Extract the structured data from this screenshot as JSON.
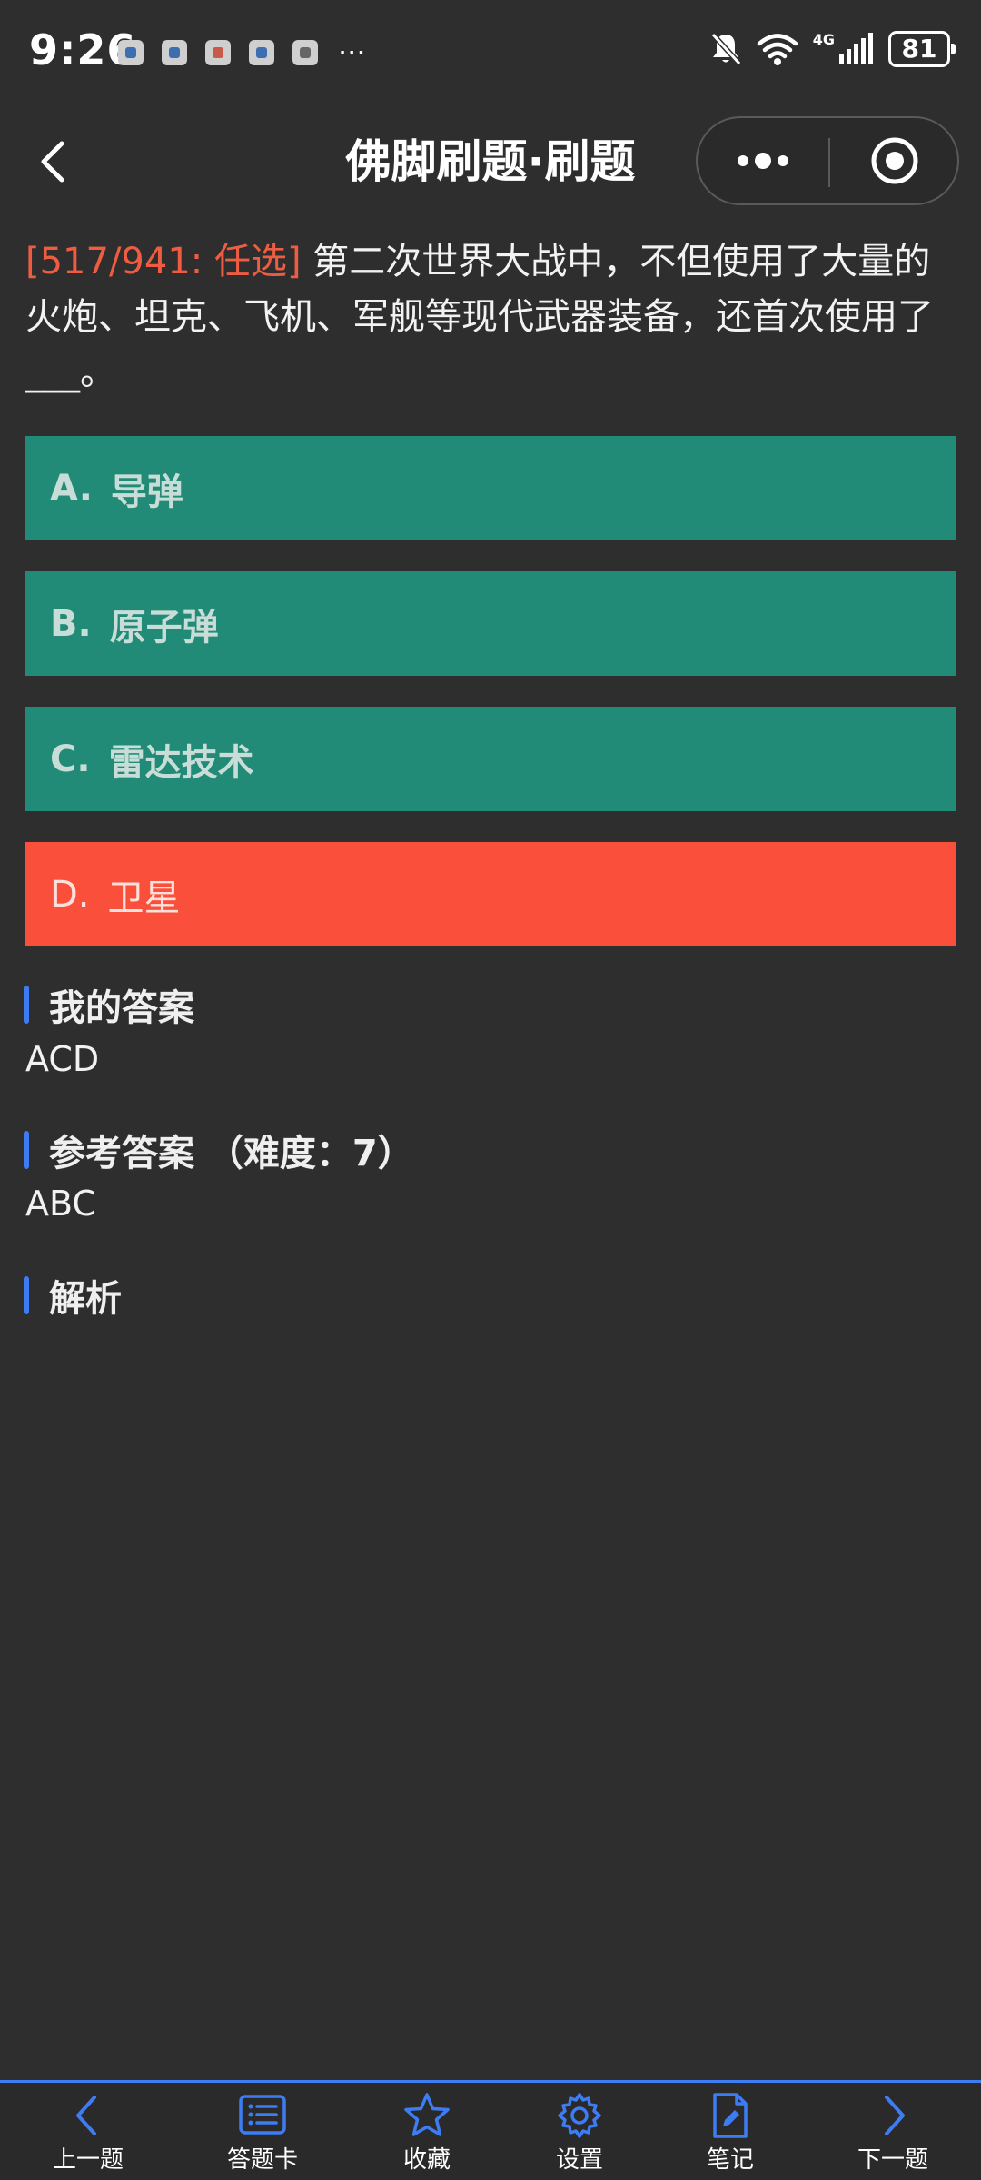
{
  "status_bar": {
    "time": "9:26",
    "more": "···",
    "network": "4G",
    "battery": "81"
  },
  "header": {
    "title": "佛脚刷题·刷题"
  },
  "question": {
    "tag": "[517/941: 任选]",
    "text": " 第二次世界大战中，不但使用了大量的火炮、坦克、飞机、军舰等现代武器装备，还首次使用了___。"
  },
  "options": [
    {
      "letter": "A.",
      "text": "导弹",
      "status": "correct"
    },
    {
      "letter": "B.",
      "text": "原子弹",
      "status": "correct"
    },
    {
      "letter": "C.",
      "text": "雷达技术",
      "status": "correct"
    },
    {
      "letter": "D.",
      "text": "卫星",
      "status": "wrong"
    }
  ],
  "my_answer": {
    "title": "我的答案",
    "value": "ACD"
  },
  "reference_answer": {
    "title": "参考答案 （难度：7）",
    "value": "ABC"
  },
  "analysis": {
    "title": "解析"
  },
  "toolbar": {
    "prev": "上一题",
    "card": "答题卡",
    "favorite": "收藏",
    "settings": "设置",
    "notes": "笔记",
    "next": "下一题"
  },
  "colors": {
    "background": "#2e2e2e",
    "correct": "#228b77",
    "wrong": "#fa4f3a",
    "accent": "#3d7cf2",
    "tag": "#ee5c42"
  }
}
